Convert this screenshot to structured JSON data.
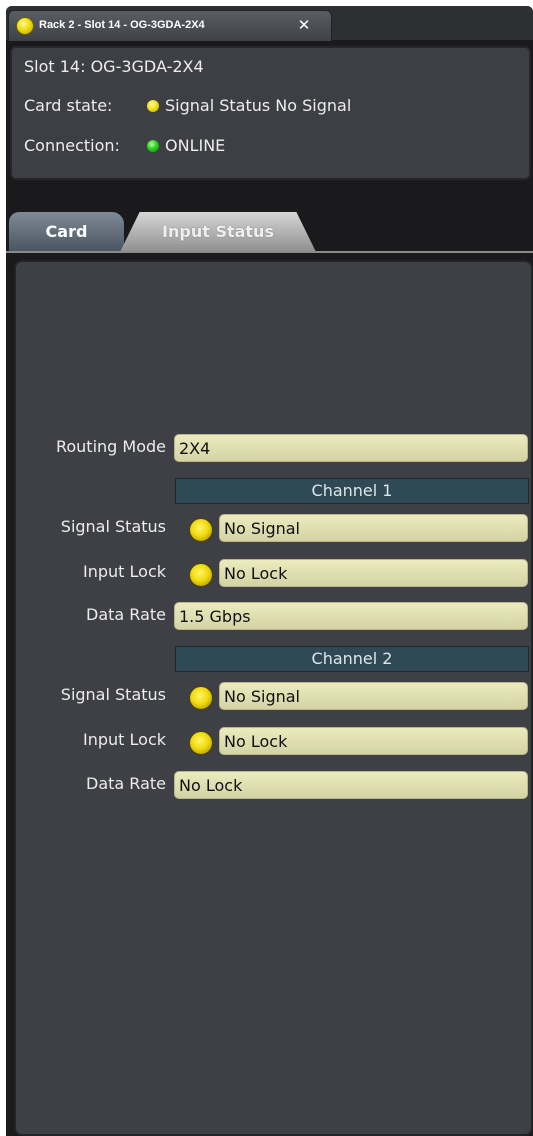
{
  "window": {
    "title": "Rack 2 - Slot 14 - OG-3GDA-2X4",
    "close_symbol": "✕"
  },
  "info": {
    "slot": "Slot 14: OG-3GDA-2X4",
    "card_state_label": "Card state:",
    "card_state_value": "Signal Status No Signal",
    "connection_label": "Connection:",
    "connection_value": "ONLINE"
  },
  "tabs": [
    {
      "label": "Card",
      "active": false
    },
    {
      "label": "Input Status",
      "active": true
    }
  ],
  "routing": {
    "label": "Routing Mode",
    "value": "2X4"
  },
  "channels": [
    {
      "header": "Channel 1",
      "signal_status_label": "Signal Status",
      "signal_status_value": "No Signal",
      "input_lock_label": "Input Lock",
      "input_lock_value": "No Lock",
      "data_rate_label": "Data Rate",
      "data_rate_value": "1.5 Gbps"
    },
    {
      "header": "Channel 2",
      "signal_status_label": "Signal Status",
      "signal_status_value": "No Signal",
      "input_lock_label": "Input Lock",
      "input_lock_value": "No Lock",
      "data_rate_label": "Data Rate",
      "data_rate_value": "No Lock"
    }
  ],
  "colors": {
    "led_yellow": "#f3e01a",
    "led_green": "#28d11b",
    "field_bg": "#e3e2b3",
    "channel_header_bg": "#2f4a55",
    "panel_bg": "#3f4045"
  },
  "icons": {
    "title_led": "yellow-status-led-icon",
    "close": "close-icon",
    "card_state_led": "yellow-status-led-icon",
    "connection_led": "green-status-led-icon",
    "row_led": "yellow-indicator-led-icon"
  }
}
